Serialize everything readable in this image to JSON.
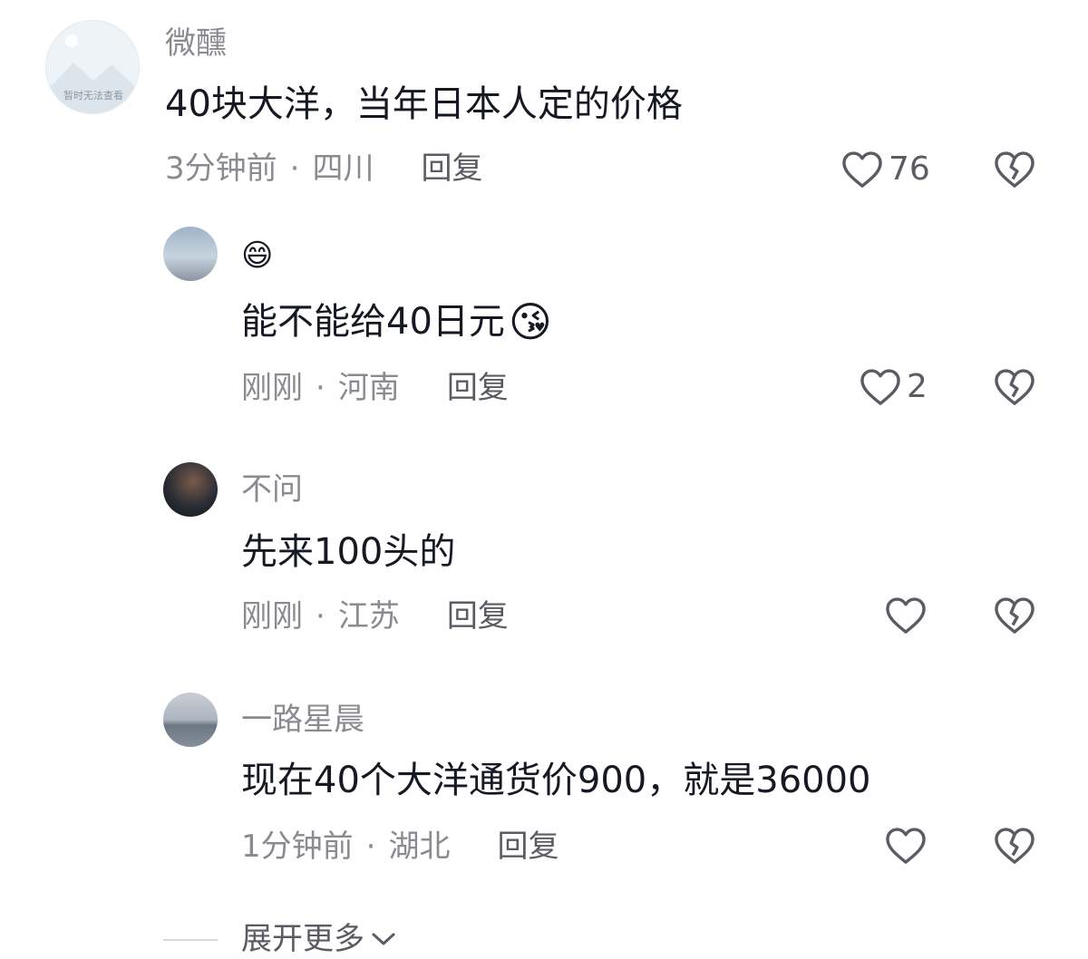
{
  "comments": [
    {
      "author": "微醺",
      "avatar_placeholder_text": "暂时无法查看",
      "text": "40块大洋，当年日本人定的价格",
      "time": "3分钟前",
      "separator": "·",
      "location": "四川",
      "reply_label": "回复",
      "likes": "76"
    },
    {
      "author_emoji": "😄",
      "text": "能不能给40日元",
      "text_emoji": "😘",
      "time": "刚刚",
      "separator": "·",
      "location": "河南",
      "reply_label": "回复",
      "likes": "2"
    },
    {
      "author": "不问",
      "text": "先来100头的",
      "time": "刚刚",
      "separator": "·",
      "location": "江苏",
      "reply_label": "回复",
      "likes": ""
    },
    {
      "author": "一路星晨",
      "text": "现在40个大洋通货价900，就是36000",
      "time": "1分钟前",
      "separator": "·",
      "location": "湖北",
      "reply_label": "回复",
      "likes": ""
    }
  ],
  "expand_label": "展开更多",
  "icons": {
    "like": "heart-outline-icon",
    "dislike": "broken-heart-icon",
    "expand": "chevron-down-icon"
  },
  "colors": {
    "text": "#161823",
    "meta": "#8a8b91",
    "icon": "#5b5c63"
  }
}
